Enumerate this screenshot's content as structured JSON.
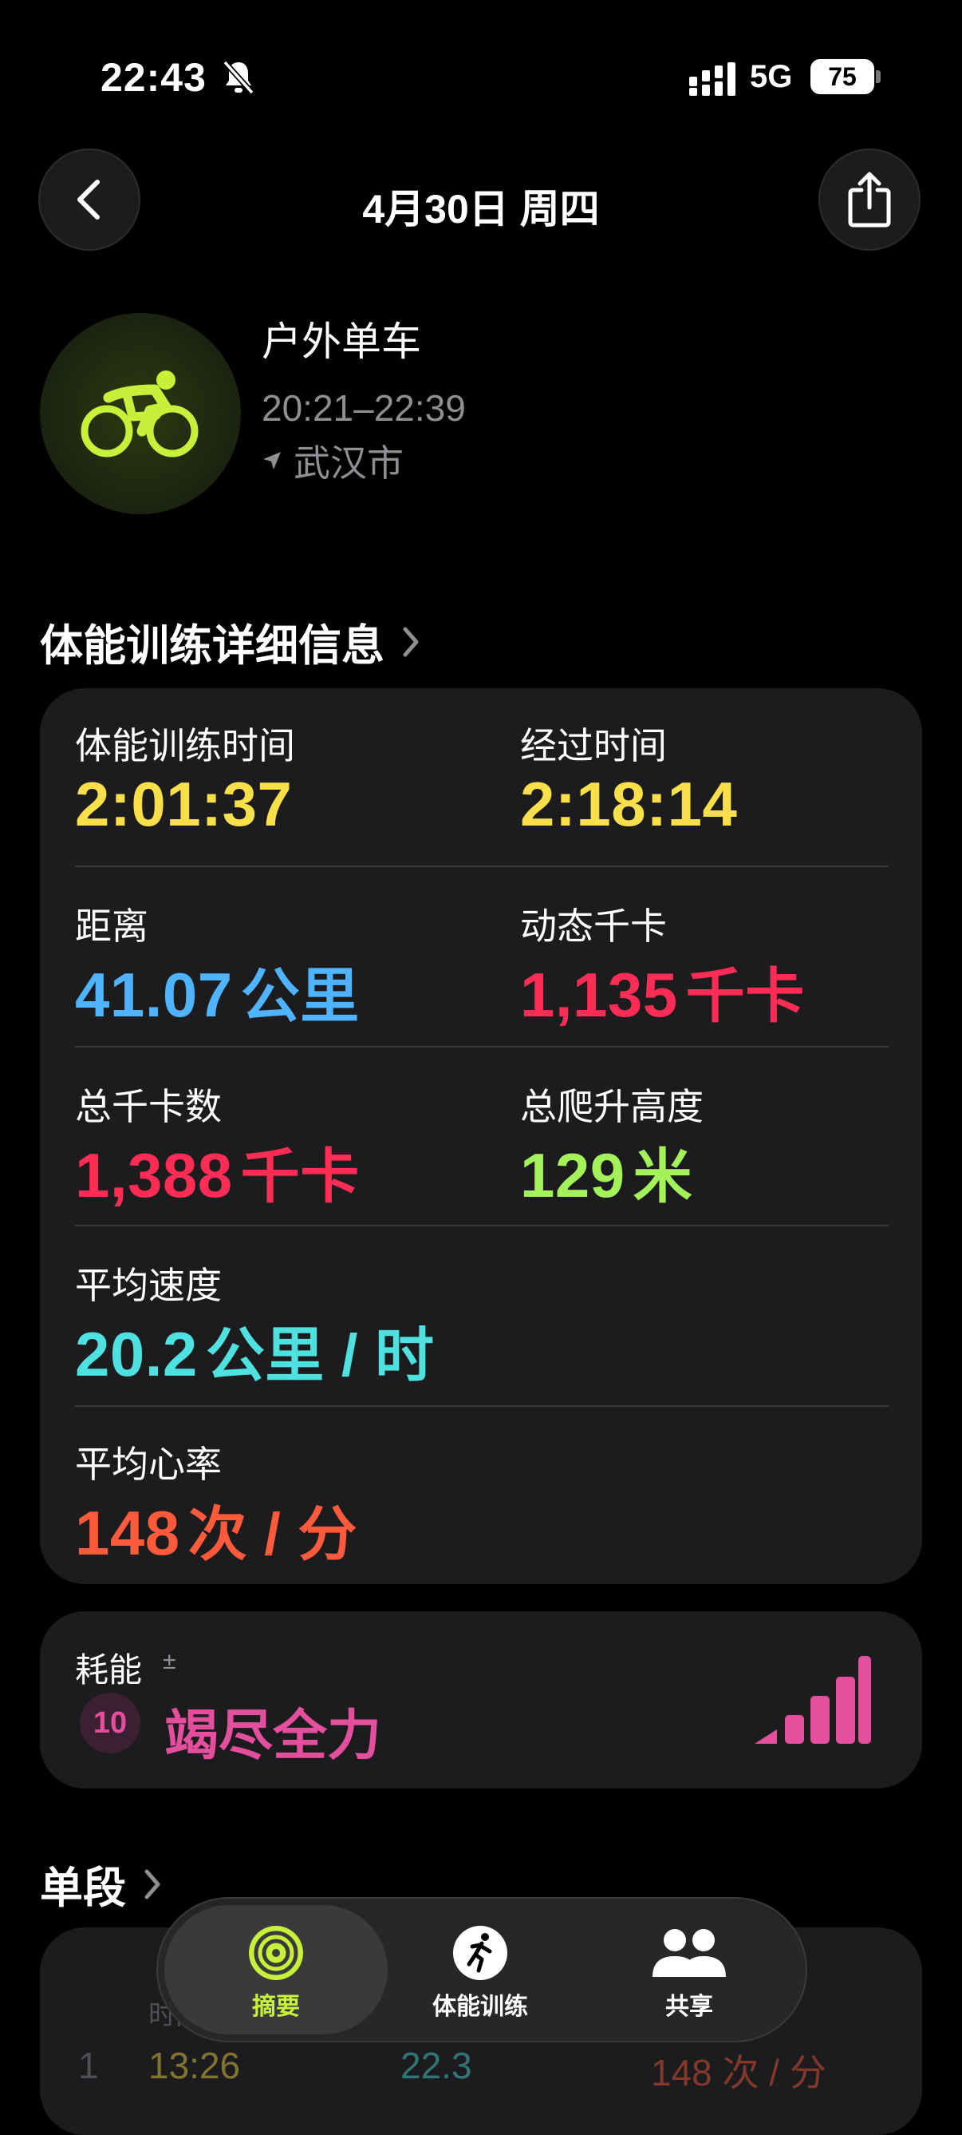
{
  "status": {
    "time": "22:43",
    "network": "5G",
    "battery": "75"
  },
  "nav": {
    "title": "4月30日 周四"
  },
  "workout": {
    "name": "户外单车",
    "time_range": "20:21–22:39",
    "location": "武汉市"
  },
  "details": {
    "section_title": "体能训练详细信息",
    "metrics": [
      {
        "label": "体能训练时间",
        "value": "2:01:37",
        "unit": ""
      },
      {
        "label": "经过时间",
        "value": "2:18:14",
        "unit": ""
      },
      {
        "label": "距离",
        "value": "41.07",
        "unit": "公里"
      },
      {
        "label": "动态千卡",
        "value": "1,135",
        "unit": "千卡"
      },
      {
        "label": "总千卡数",
        "value": "1,388",
        "unit": "千卡"
      },
      {
        "label": "总爬升高度",
        "value": "129",
        "unit": "米"
      },
      {
        "label": "平均速度",
        "value": "20.2",
        "unit": "公里 / 时"
      },
      {
        "label": "平均心率",
        "value": "148",
        "unit": "次 / 分"
      }
    ]
  },
  "effort": {
    "label": "耗能",
    "plusminus": "±",
    "score": "10",
    "text": "竭尽全力",
    "level": 1.0
  },
  "segments": {
    "section_title": "单段",
    "header_time": "时间",
    "rows": [
      {
        "index": "1",
        "time": "13:26",
        "speed": "22.3",
        "hr": "148 次 / 分"
      }
    ]
  },
  "tabs": [
    {
      "label": "摘要"
    },
    {
      "label": "体能训练"
    },
    {
      "label": "共享"
    }
  ],
  "colors": {
    "yellow": "#f9e04b",
    "blue": "#4fb3ff",
    "red": "#ff2d55",
    "green": "#a4f25a",
    "cyan": "#4fe0e0",
    "orange": "#ff5a3c",
    "pink": "#e34f9c",
    "accent_lime": "#c7f03a"
  }
}
